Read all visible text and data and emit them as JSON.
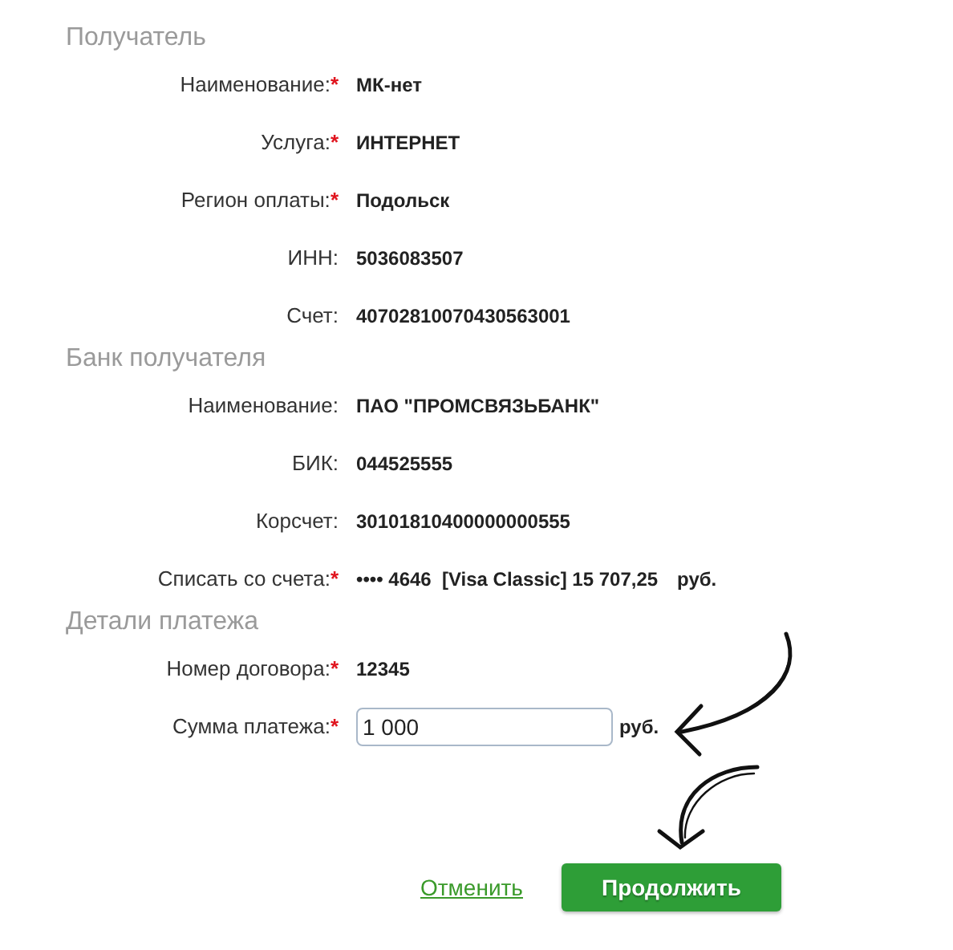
{
  "sections": [
    {
      "title": "Получатель",
      "fields": [
        {
          "label": "Наименование:",
          "mark": "*",
          "kind": "text",
          "value": "МК-нет"
        },
        {
          "label": "Услуга:",
          "mark": "*",
          "kind": "text",
          "value": "ИНТЕРНЕТ"
        },
        {
          "label": "Регион оплаты:",
          "mark": "*",
          "kind": "text",
          "value": "Подольск"
        },
        {
          "label": "ИНН:",
          "kind": "text",
          "value": "5036083507"
        },
        {
          "label": "Счет:",
          "kind": "text",
          "value": "40702810070430563001"
        }
      ]
    },
    {
      "title": "Банк получателя",
      "fields": [
        {
          "label": "Наименование:",
          "kind": "text",
          "value": "ПАО \"ПРОМСВЯЗЬБАНК\""
        },
        {
          "label": "БИК:",
          "kind": "text",
          "value": "044525555"
        },
        {
          "label": "Корсчет:",
          "kind": "text",
          "value": "30101810400000000555"
        },
        {
          "label": "Списать со счета:",
          "mark": "*",
          "kind": "text",
          "value": "•••• 4646  [Visa Classic] 15 707,25",
          "unit": "руб."
        }
      ]
    },
    {
      "title": "Детали платежа",
      "fields": [
        {
          "label": "Номер договора:",
          "mark": "*",
          "kind": "text",
          "value": "12345"
        },
        {
          "label": "Сумма платежа:",
          "mark": "*",
          "kind": "input",
          "value": "1 000",
          "unit": "руб."
        }
      ]
    }
  ],
  "actions": {
    "cancel": "Отменить",
    "submit": "Продолжить"
  }
}
